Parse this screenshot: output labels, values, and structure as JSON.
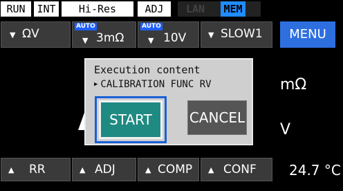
{
  "status": {
    "run": "RUN",
    "int": "INT",
    "hires": "Hi-Res",
    "adj": "ADJ",
    "lan": "LAN",
    "mem": "MEM"
  },
  "top_keys": {
    "function": "ΩV",
    "resistance_range": "3mΩ",
    "voltage_range": "10V",
    "speed": "SLOW1",
    "auto_badge": "AUTO",
    "menu": "MENU"
  },
  "units": {
    "resistance": "mΩ",
    "voltage": "V"
  },
  "dialog": {
    "title": "Execution content",
    "function": "CALIBRATION FUNC RV",
    "start": "START",
    "cancel": "CANCEL"
  },
  "bottom_keys": {
    "rr": "RR",
    "adj": "ADJ",
    "comp": "COMP",
    "conf": "CONF"
  },
  "temperature": "24.7 °C",
  "icons": {
    "down_arrow": "triangle-down-icon",
    "up_arrow": "triangle-up-icon",
    "pointer": "triangle-right-icon"
  },
  "colors": {
    "menu_blue": "#2e6fe0",
    "start_teal": "#1f8a82",
    "focus_blue": "#1a5fd8",
    "mem_blue": "#1f8cff",
    "dialog_gray": "#cfcfcf"
  }
}
